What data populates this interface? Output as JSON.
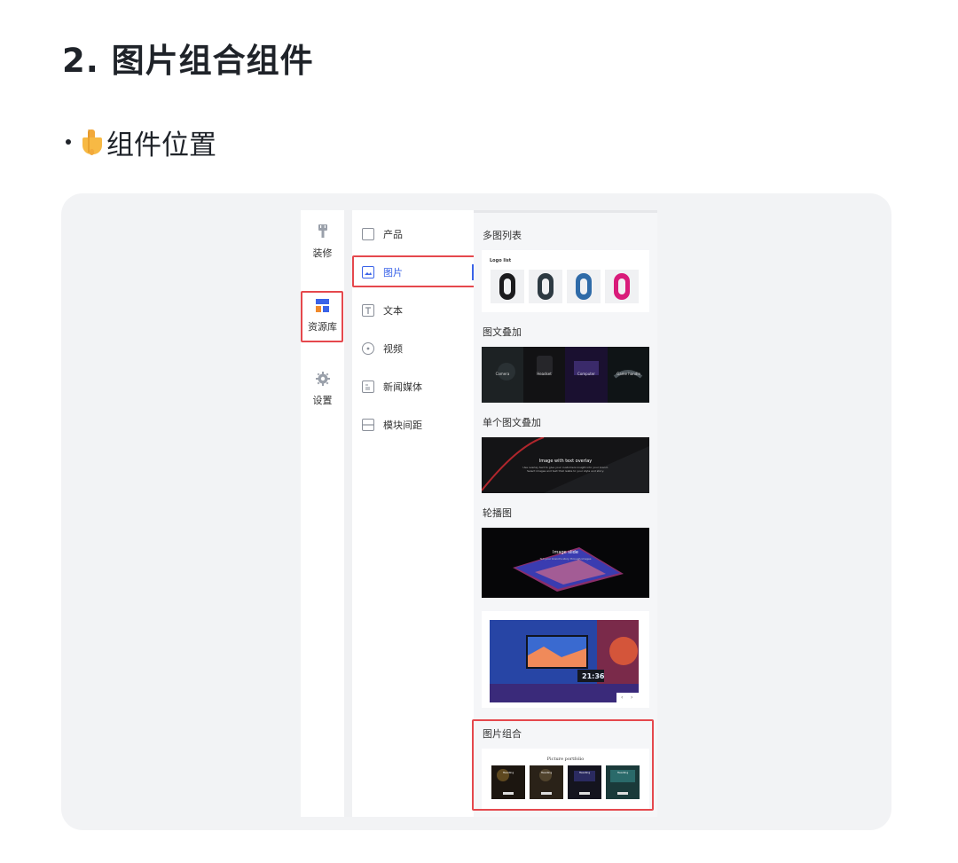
{
  "heading": "2. 图片组合组件",
  "bullet": {
    "emoji": "pointing-down-hand-emoji",
    "text": "组件位置"
  },
  "rail": {
    "items": [
      {
        "label": "装修",
        "icon": "brush-icon"
      },
      {
        "label": "资源库",
        "icon": "layout-grid-icon"
      },
      {
        "label": "设置",
        "icon": "gear-icon"
      }
    ]
  },
  "menu": {
    "items": [
      {
        "label": "产品",
        "icon": "box-icon"
      },
      {
        "label": "图片",
        "icon": "image-icon"
      },
      {
        "label": "文本",
        "icon": "text-icon"
      },
      {
        "label": "视频",
        "icon": "play-circle-icon"
      },
      {
        "label": "新闻媒体",
        "icon": "news-icon"
      },
      {
        "label": "模块间距",
        "icon": "spacing-icon"
      }
    ]
  },
  "library": {
    "sections": [
      {
        "label": "多图列表"
      },
      {
        "label": "图文叠加"
      },
      {
        "label": "单个图文叠加"
      },
      {
        "label": "轮播图"
      },
      {
        "label": "图片组合"
      }
    ],
    "logo_list_caption": "Logo list",
    "overlay_captions": [
      "Camera",
      "Headset",
      "Computer",
      "Game handle"
    ],
    "single_overlay_title": "Image with text overlay",
    "single_overlay_sub": "Use overlay text to give your customers insight into your brand. Select images and text that relate to your style and story.",
    "slide_title": "Image slide",
    "slide_sub": "Tell your brand's story through images",
    "clock_text": "21:36",
    "portfolio_title": "Picture portfolio",
    "portfolio_heading": "Heading"
  },
  "colors": {
    "accent": "#3a63e8",
    "highlight_box": "#e5484d",
    "frame_bg": "#f2f3f5"
  }
}
